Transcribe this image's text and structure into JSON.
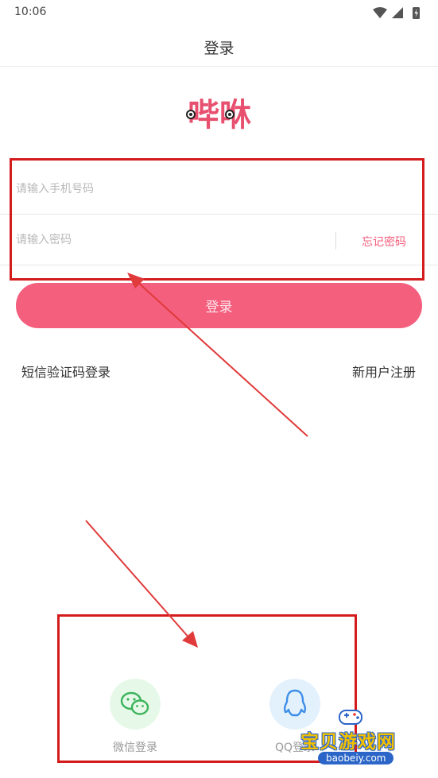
{
  "status_bar": {
    "time": "10:06"
  },
  "nav": {
    "title": "登录"
  },
  "logo": {
    "text": "哔咻",
    "color": "#e8506f"
  },
  "form": {
    "phone_placeholder": "请输入手机号码",
    "password_placeholder": "请输入密码",
    "forgot_label": "忘记密码"
  },
  "login_button": {
    "label": "登录",
    "color": "#f45f7e"
  },
  "links": {
    "sms_login": "短信验证码登录",
    "register": "新用户注册"
  },
  "social": {
    "wechat_label": "微信登录",
    "qq_label": "QQ登录"
  },
  "annotations": {
    "color": "#d41c1c"
  },
  "watermark": {
    "title": "宝贝游戏网",
    "domain": "baobeiy.com"
  }
}
